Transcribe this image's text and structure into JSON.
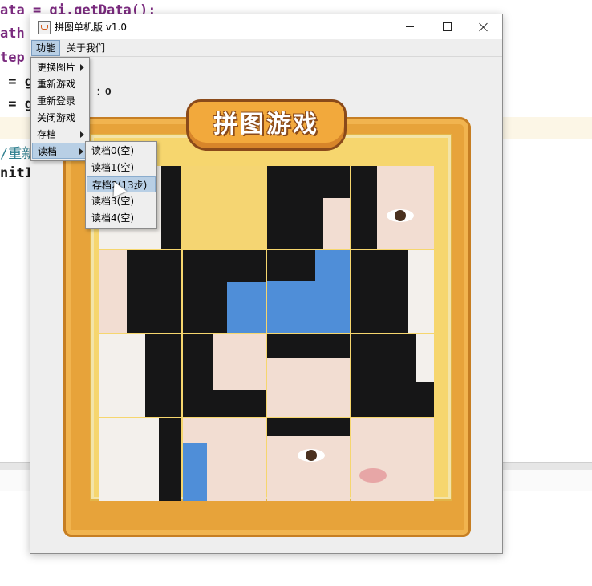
{
  "ide": {
    "lines": [
      {
        "text": "ata = gi.getData();"
      },
      {
        "text": "ath"
      },
      {
        "text": "tep"
      },
      {
        "text": " = g"
      },
      {
        "text": " = g"
      },
      {
        "text": "/重新"
      },
      {
        "text": "nitI"
      }
    ]
  },
  "window": {
    "title": "拼图单机版 v1.0",
    "minimize": "minimize-icon",
    "maximize": "maximize-icon",
    "close": "close-icon"
  },
  "menubar": {
    "function": "功能",
    "about": "关于我们"
  },
  "function_menu": {
    "items": [
      {
        "label": "更换图片",
        "submenu": true
      },
      {
        "label": "重新游戏",
        "submenu": false
      },
      {
        "label": "重新登录",
        "submenu": false
      },
      {
        "label": "关闭游戏",
        "submenu": false
      },
      {
        "label": "存档",
        "submenu": true
      },
      {
        "label": "读档",
        "submenu": true
      }
    ]
  },
  "load_submenu": {
    "items": [
      {
        "label": "读档0(空)"
      },
      {
        "label": "读档1(空)"
      },
      {
        "label": "存档2(13步)"
      },
      {
        "label": "读档3(空)"
      },
      {
        "label": "读档4(空)"
      }
    ],
    "highlighted_index": 2
  },
  "game": {
    "step_text": "：0",
    "logo_text": "拼图游戏",
    "grid_size": 4,
    "colors": {
      "board": "#e7a33a",
      "empty_tile": "#f5d572",
      "highlight": "#b8cfe5"
    }
  }
}
